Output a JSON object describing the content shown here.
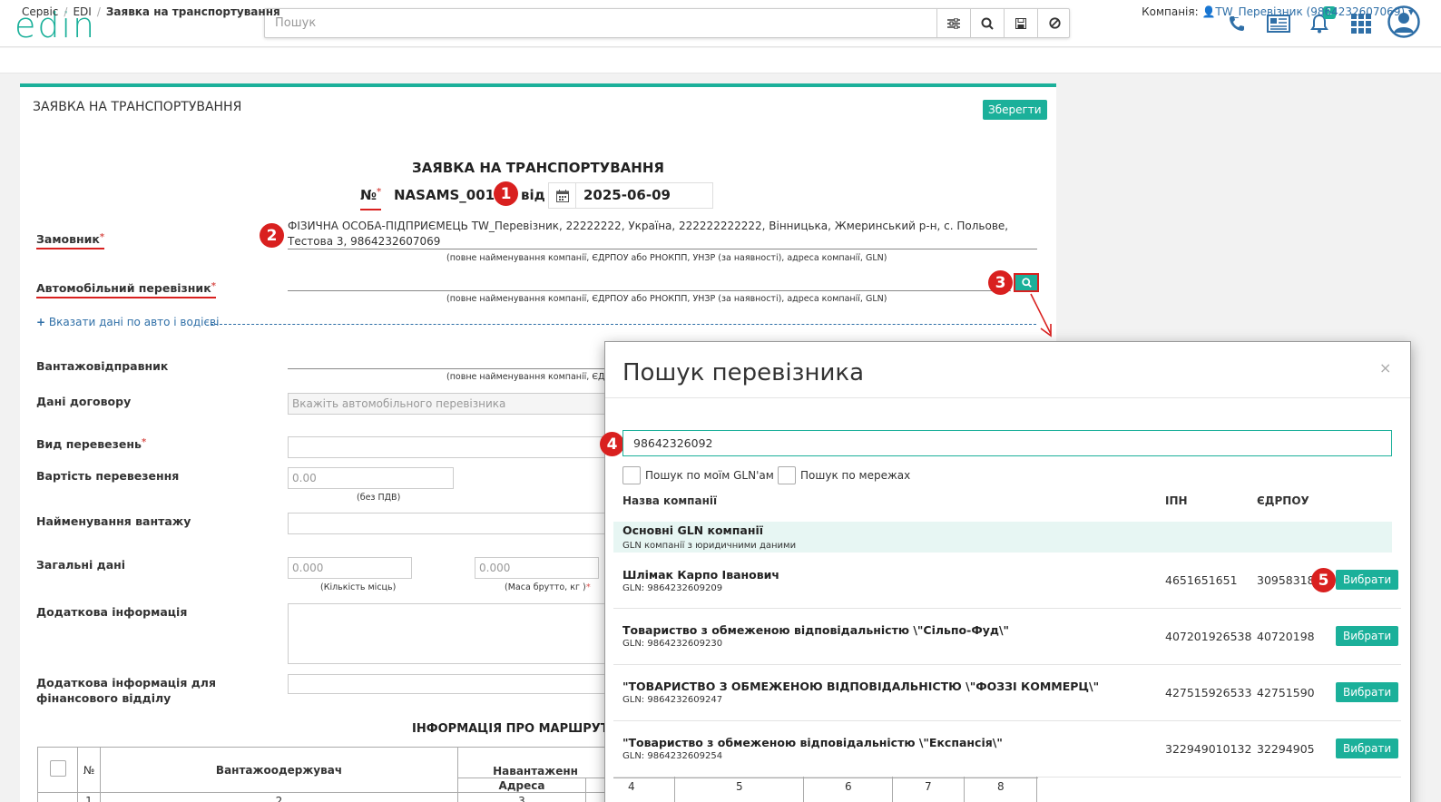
{
  "header": {
    "logo": "edin",
    "search_placeholder": "Пошук",
    "notifications_count": "1"
  },
  "breadcrumb": {
    "items": [
      "Сервіс",
      "EDI",
      "Заявка на транспортування"
    ],
    "company_label": "Компанія:",
    "company_value": "TW_Перевізник (9864232607069)"
  },
  "form": {
    "panel_title": "ЗАЯВКА НА ТРАНСПОРТУВАННЯ",
    "save_label": "Зберегти",
    "doc_heading": "ЗАЯВКА НА ТРАНСПОРТУВАННЯ",
    "number_label": "№",
    "number_value": "NASAMS_001",
    "date_prefix": "від",
    "date_value": "2025-06-09",
    "customer_label": "Замовник",
    "customer_value": "ФІЗИЧНА ОСОБА-ПІДПРИЄМЕЦЬ TW_Перевізник, 22222222, Україна, 222222222222, Вінницька, Жмеринський р-н, с. Польове, Тестова 3, 9864232607069",
    "company_hint": "(повне найменування компанії, ЄДРПОУ або РНОКПП, УНЗР (за наявності), адреса компанії, GLN)",
    "carrier_label": "Автомобільний перевізник",
    "add_vehicle_link": "Вказати дані по авто і водієві",
    "shipper_label": "Вантажовідправник",
    "shipper_hint": "(повне найменування компанії, ЄД",
    "contract_label": "Дані договору",
    "contract_placeholder": "Вкажіть автомобільного перевізника",
    "transport_type_label": "Вид перевезень",
    "cost_label": "Вартість перевезення",
    "cost_placeholder": "0.00",
    "cost_hint": "(без ПДВ)",
    "cargo_name_label": "Найменування вантажу",
    "general_label": "Загальні дані",
    "places_placeholder": "0.000",
    "places_hint": "(Кількість місць)",
    "mass_placeholder": "0.000",
    "mass_hint": "(Маса брутто, кг )",
    "extra_info_label": "Додаткова інформація",
    "fin_info_label": "Додаткова інформація для фінансового відділу",
    "route_heading": "ІНФОРМАЦІЯ ПРО МАРШРУТ І В"
  },
  "route_table": {
    "col_no": "№",
    "col_consignee": "Вантажоодержувач",
    "col_loading": "Навантаженн",
    "col_address": "Адреса",
    "row_nums": [
      "1",
      "2",
      "3"
    ]
  },
  "modal": {
    "title": "Пошук перевізника",
    "close": "×",
    "query": "98642326092",
    "check_gln": "Пошук по моїм GLN'ам",
    "check_network": "Пошук по мережах",
    "col_name": "Назва компанії",
    "col_ipn": "ІПН",
    "col_edrpou": "ЄДРПОУ",
    "group_title": "Основні GLN компанії",
    "group_sub": "GLN компанії з юридичними даними",
    "select_label": "Вибрати",
    "rows": [
      {
        "name": "Шлімак Карпо Іванович",
        "gln": "GLN: 9864232609209",
        "ipn": "4651651651",
        "edrpou": "30958318"
      },
      {
        "name": "Товариство з обмеженою відповідальністю \\\"Сільпо-Фуд\\\"",
        "gln": "GLN: 9864232609230",
        "ipn": "407201926538",
        "edrpou": "40720198"
      },
      {
        "name": "\"ТОВАРИСТВО З ОБМЕЖЕНОЮ ВІДПОВІДАЛЬНІСТЮ \\\"ФОЗЗІ КОММЕРЦ\\\"",
        "gln": "GLN: 9864232609247",
        "ipn": "427515926533",
        "edrpou": "42751590"
      },
      {
        "name": "\"Товариство з обмеженою відповідальністю \\\"Експансія\\\"",
        "gln": "GLN: 9864232609254",
        "ipn": "322949010132",
        "edrpou": "32294905"
      }
    ],
    "footer_nums": [
      "4",
      "5",
      "6",
      "7",
      "8"
    ]
  },
  "markers": [
    "1",
    "2",
    "3",
    "4",
    "5"
  ],
  "colors": {
    "accent": "#1bb09a",
    "link": "#2f6fa7",
    "marker": "#d9201f"
  }
}
